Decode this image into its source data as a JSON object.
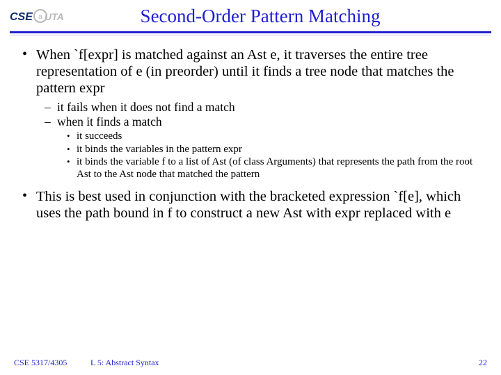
{
  "logo": {
    "text1": "CSE",
    "text2": "UTA",
    "at": "@"
  },
  "title": "Second-Order Pattern Matching",
  "bullets": [
    {
      "text": "When `f[expr] is matched against an Ast  e, it traverses the entire tree representation of e (in preorder) until it finds a tree node that matches the pattern expr",
      "sub": [
        {
          "text": "it fails when it does not find a match"
        },
        {
          "text": "when it finds a match",
          "sub": [
            {
              "text": "it succeeds"
            },
            {
              "text": "it binds the variables in the pattern expr"
            },
            {
              "text": "it binds the variable f to a list of Ast (of class Arguments) that represents the path from the root Ast to the Ast node that matched the pattern"
            }
          ]
        }
      ]
    },
    {
      "text": "This is best used in conjunction with the bracketed expression `f[e], which uses the path bound in f to construct a new Ast with expr replaced with e"
    }
  ],
  "footer": {
    "course": "CSE 5317/4305",
    "lesson": "L 5: Abstract Syntax",
    "page": "22"
  }
}
